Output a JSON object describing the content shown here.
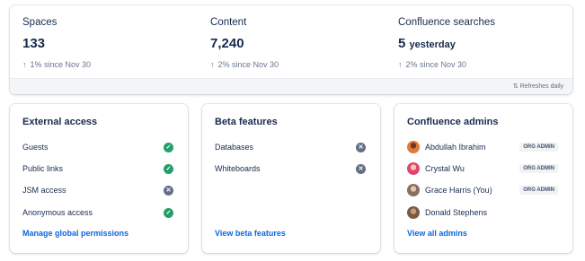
{
  "stats": {
    "spaces": {
      "label": "Spaces",
      "value": "133",
      "change": "1% since Nov 30"
    },
    "content": {
      "label": "Content",
      "value": "7,240",
      "change": "2% since Nov 30"
    },
    "searches": {
      "label": "Confluence searches",
      "value": "5",
      "suffix": "yesterday",
      "change": "2% since Nov 30"
    },
    "refresh_label": "Refreshes daily",
    "change_icon": "arrow-up-icon",
    "refresh_icon": "refresh-icon"
  },
  "external_access": {
    "title": "External access",
    "items": [
      {
        "label": "Guests",
        "status": "enabled"
      },
      {
        "label": "Public links",
        "status": "enabled"
      },
      {
        "label": "JSM access",
        "status": "disabled"
      },
      {
        "label": "Anonymous access",
        "status": "enabled"
      }
    ],
    "link": "Manage global permissions"
  },
  "beta_features": {
    "title": "Beta features",
    "items": [
      {
        "label": "Databases",
        "status": "disabled"
      },
      {
        "label": "Whiteboards",
        "status": "disabled"
      }
    ],
    "link": "View beta features"
  },
  "admins": {
    "title": "Confluence admins",
    "items": [
      {
        "name": "Abdullah Ibrahim",
        "badge": "ORG ADMIN"
      },
      {
        "name": "Crystal Wu",
        "badge": "ORG ADMIN"
      },
      {
        "name": "Grace Harris (You)",
        "badge": "ORG ADMIN"
      },
      {
        "name": "Donald Stephens",
        "badge": ""
      }
    ],
    "link": "View all admins"
  },
  "colors": {
    "enabled": "#22a06b",
    "disabled": "#626f86",
    "link": "#0c66e4"
  }
}
